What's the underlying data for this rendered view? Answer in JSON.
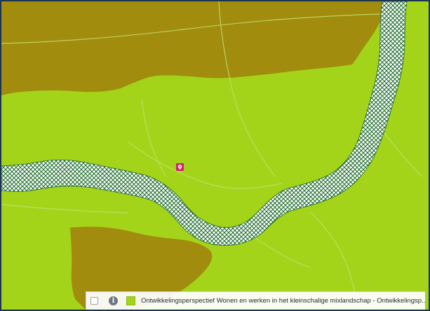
{
  "map": {
    "colors": {
      "base_green": "#a4d41a",
      "olive_zone": "#a18c0e",
      "corridor_fill": "#ffffff",
      "corridor_hatch": "#1e6b2c",
      "road_line": "#bfe06a",
      "marker": "#d6206c",
      "frame_border": "#1b3550"
    },
    "marker_icon": "location-pin-icon"
  },
  "legend": {
    "checkbox_icon": "checkbox-icon",
    "checked": false,
    "info_icon": "info-icon",
    "info_symbol": "i",
    "swatch_color": "#a4d41a",
    "label": "Ontwikkelingsperspectief Wonen en werken in het kleinschalige mixlandschap - Ontwikkelingsp..."
  }
}
